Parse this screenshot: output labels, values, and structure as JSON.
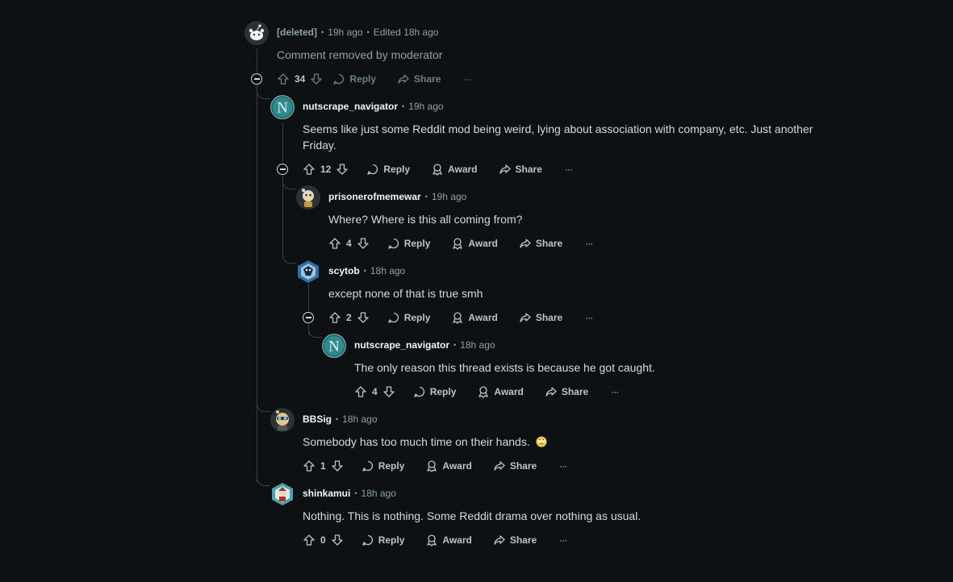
{
  "comments": [
    {
      "author": "[deleted]",
      "time": "19h ago",
      "edited": "Edited 18h ago",
      "body": "Comment removed by moderator",
      "votes": "34",
      "reply": "Reply",
      "share": "Share"
    },
    {
      "author": "nutscrape_navigator",
      "time": "19h ago",
      "body": "Seems like just some Reddit mod being weird, lying about association with company, etc. Just another Friday.",
      "votes": "12",
      "reply": "Reply",
      "award": "Award",
      "share": "Share"
    },
    {
      "author": "prisonerofmemewar",
      "time": "19h ago",
      "body": "Where? Where is this all coming from?",
      "votes": "4",
      "reply": "Reply",
      "award": "Award",
      "share": "Share"
    },
    {
      "author": "scytob",
      "time": "18h ago",
      "body": "except none of that is true smh",
      "votes": "2",
      "reply": "Reply",
      "award": "Award",
      "share": "Share"
    },
    {
      "author": "nutscrape_navigator",
      "time": "18h ago",
      "body": "The only reason this thread exists is because he got caught.",
      "votes": "4",
      "reply": "Reply",
      "award": "Award",
      "share": "Share"
    },
    {
      "author": "BBSig",
      "time": "18h ago",
      "body": "Somebody has too much time on their hands.",
      "votes": "1",
      "reply": "Reply",
      "award": "Award",
      "share": "Share"
    },
    {
      "author": "shinkamui",
      "time": "18h ago",
      "body": "Nothing. This is nothing. Some Reddit drama over nothing as usual.",
      "votes": "0",
      "reply": "Reply",
      "award": "Award",
      "share": "Share"
    }
  ],
  "more_glyph": "···",
  "separator": "•",
  "icons": {
    "upvote": "upvote-icon",
    "downvote": "downvote-icon",
    "reply": "reply-icon",
    "award": "award-icon",
    "share": "share-icon",
    "more": "more-icon",
    "collapse": "collapse-icon",
    "emoji": "rolling-eyes-emoji"
  },
  "colors": {
    "background": "#0e1113",
    "text": "#d7dadc",
    "meta": "#8ba2ad",
    "thread": "#3a4246"
  }
}
